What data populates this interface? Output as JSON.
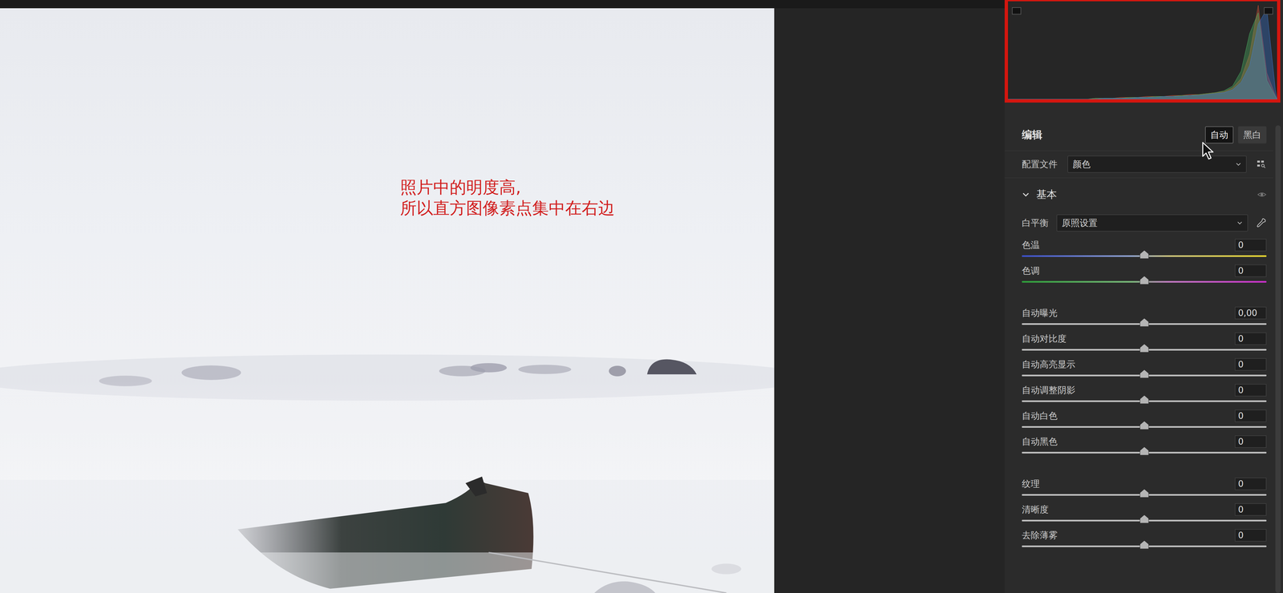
{
  "annotation": {
    "lines": [
      "照片中的明度高,",
      "所以直方图像素点集中在右边"
    ]
  },
  "histogram": {
    "series": [
      {
        "channel": "red",
        "color": "#e0553a",
        "values": [
          0,
          0,
          0,
          0,
          0,
          0,
          0,
          0,
          0,
          0,
          1,
          1,
          1,
          2,
          2,
          2,
          3,
          3,
          3,
          4,
          4,
          5,
          5,
          6,
          7,
          8,
          12,
          22,
          48,
          100,
          28,
          4
        ]
      },
      {
        "channel": "green",
        "color": "#4fbf6a",
        "values": [
          0,
          0,
          0,
          0,
          0,
          0,
          0,
          0,
          0,
          0,
          1,
          1,
          1,
          1,
          2,
          2,
          2,
          3,
          3,
          3,
          4,
          4,
          5,
          6,
          7,
          9,
          14,
          30,
          70,
          92,
          20,
          3
        ]
      },
      {
        "channel": "blue",
        "color": "#3d7fe0",
        "values": [
          0,
          0,
          0,
          0,
          0,
          0,
          0,
          0,
          0,
          0,
          0,
          1,
          1,
          1,
          1,
          2,
          2,
          2,
          3,
          3,
          3,
          4,
          4,
          5,
          6,
          7,
          10,
          18,
          36,
          80,
          96,
          10
        ]
      }
    ]
  },
  "edit": {
    "title": "编辑",
    "modes": [
      {
        "label": "自动",
        "selected": true
      },
      {
        "label": "黑白",
        "selected": false
      }
    ]
  },
  "profile": {
    "label": "配置文件",
    "value": "颜色"
  },
  "basic": {
    "title": "基本",
    "expanded": true,
    "white_balance": {
      "label": "白平衡",
      "value": "原照设置"
    },
    "groups": [
      {
        "sliders": [
          {
            "label": "色温",
            "value": "0",
            "level": 0.5,
            "kind": "temp"
          },
          {
            "label": "色调",
            "value": "0",
            "level": 0.5,
            "kind": "tint"
          }
        ]
      },
      {
        "sliders": [
          {
            "label": "自动曝光",
            "value": "0,00",
            "level": 0.5,
            "kind": "plain"
          },
          {
            "label": "自动对比度",
            "value": "0",
            "level": 0.5,
            "kind": "plain"
          },
          {
            "label": "自动高亮显示",
            "value": "0",
            "level": 0.5,
            "kind": "plain"
          },
          {
            "label": "自动调整阴影",
            "value": "0",
            "level": 0.5,
            "kind": "plain"
          },
          {
            "label": "自动白色",
            "value": "0",
            "level": 0.5,
            "kind": "plain"
          },
          {
            "label": "自动黑色",
            "value": "0",
            "level": 0.5,
            "kind": "plain"
          }
        ]
      },
      {
        "sliders": [
          {
            "label": "纹理",
            "value": "0",
            "level": 0.5,
            "kind": "plain"
          },
          {
            "label": "清晰度",
            "value": "0",
            "level": 0.5,
            "kind": "plain"
          },
          {
            "label": "去除薄雾",
            "value": "0",
            "level": 0.5,
            "kind": "plain"
          }
        ]
      }
    ]
  }
}
